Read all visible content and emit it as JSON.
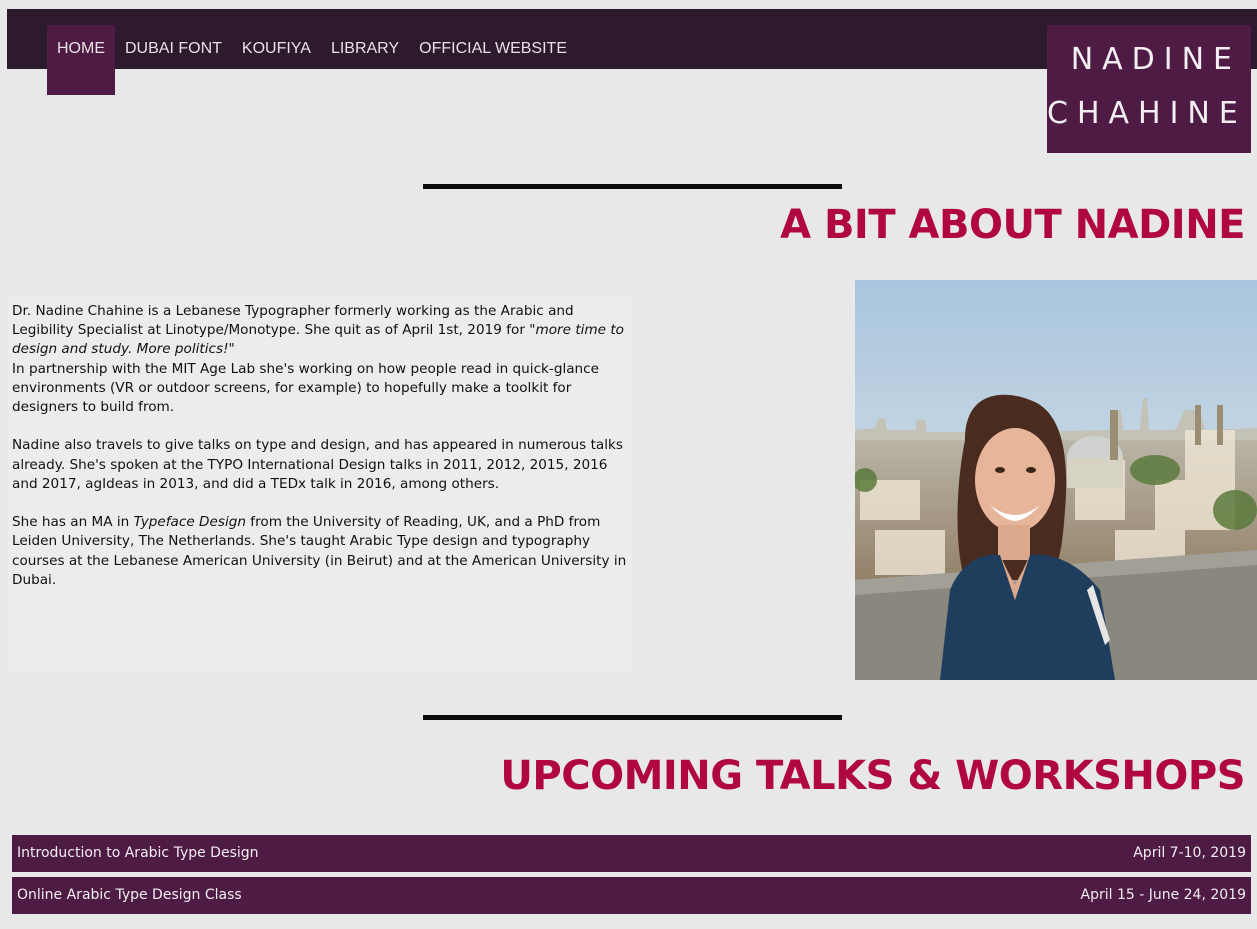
{
  "nav": {
    "items": [
      {
        "label": "HOME",
        "active": true
      },
      {
        "label": "DUBAI FONT",
        "active": false
      },
      {
        "label": "KOUFIYA",
        "active": false
      },
      {
        "label": "LIBRARY",
        "active": false
      },
      {
        "label": "OFFICIAL WEBSITE",
        "active": false
      }
    ]
  },
  "logo": {
    "line1": "NADINE",
    "line2": "CHAHINE"
  },
  "about": {
    "title": "A BIT ABOUT NADINE",
    "p1_a": "Dr. Nadine Chahine is a Lebanese Typographer formerly working as the Arabic and Legibility Specialist at Linotype/Monotype. She quit as of April 1st, 2019 for ",
    "p1_quote": "\"more time to design and study. More politics!\"",
    "p1_b": "In partnership with the MIT Age Lab she's working on how people read in quick-glance environments (VR or outdoor screens, for example) to hopefully make a toolkit for designers to build from.",
    "p2": "Nadine also travels to give talks on type and design, and has appeared in numerous talks already. She's spoken at the TYPO International Design talks in 2011, 2012, 2015, 2016 and 2017, agIdeas in 2013, and did a TEDx talk in 2016, among others.",
    "p3_a": "She has an MA in ",
    "p3_em": "Typeface Design",
    "p3_b": " from the University of Reading, UK, and a PhD from Leiden University, The Netherlands. She's taught Arabic Type design and typography courses at the Lebanese American University (in Beirut) and at the American University in Dubai."
  },
  "talks": {
    "title": "UPCOMING TALKS & WORKSHOPS",
    "events": [
      {
        "name": "Introduction to Arabic Type Design",
        "date": "April 7-10, 2019"
      },
      {
        "name": "Online Arabic Type Design Class",
        "date": "April 15 - June 24, 2019"
      }
    ]
  },
  "colors": {
    "accent": "#b0073f",
    "brand": "#4e1b44",
    "topbar": "#2d1a2c"
  }
}
